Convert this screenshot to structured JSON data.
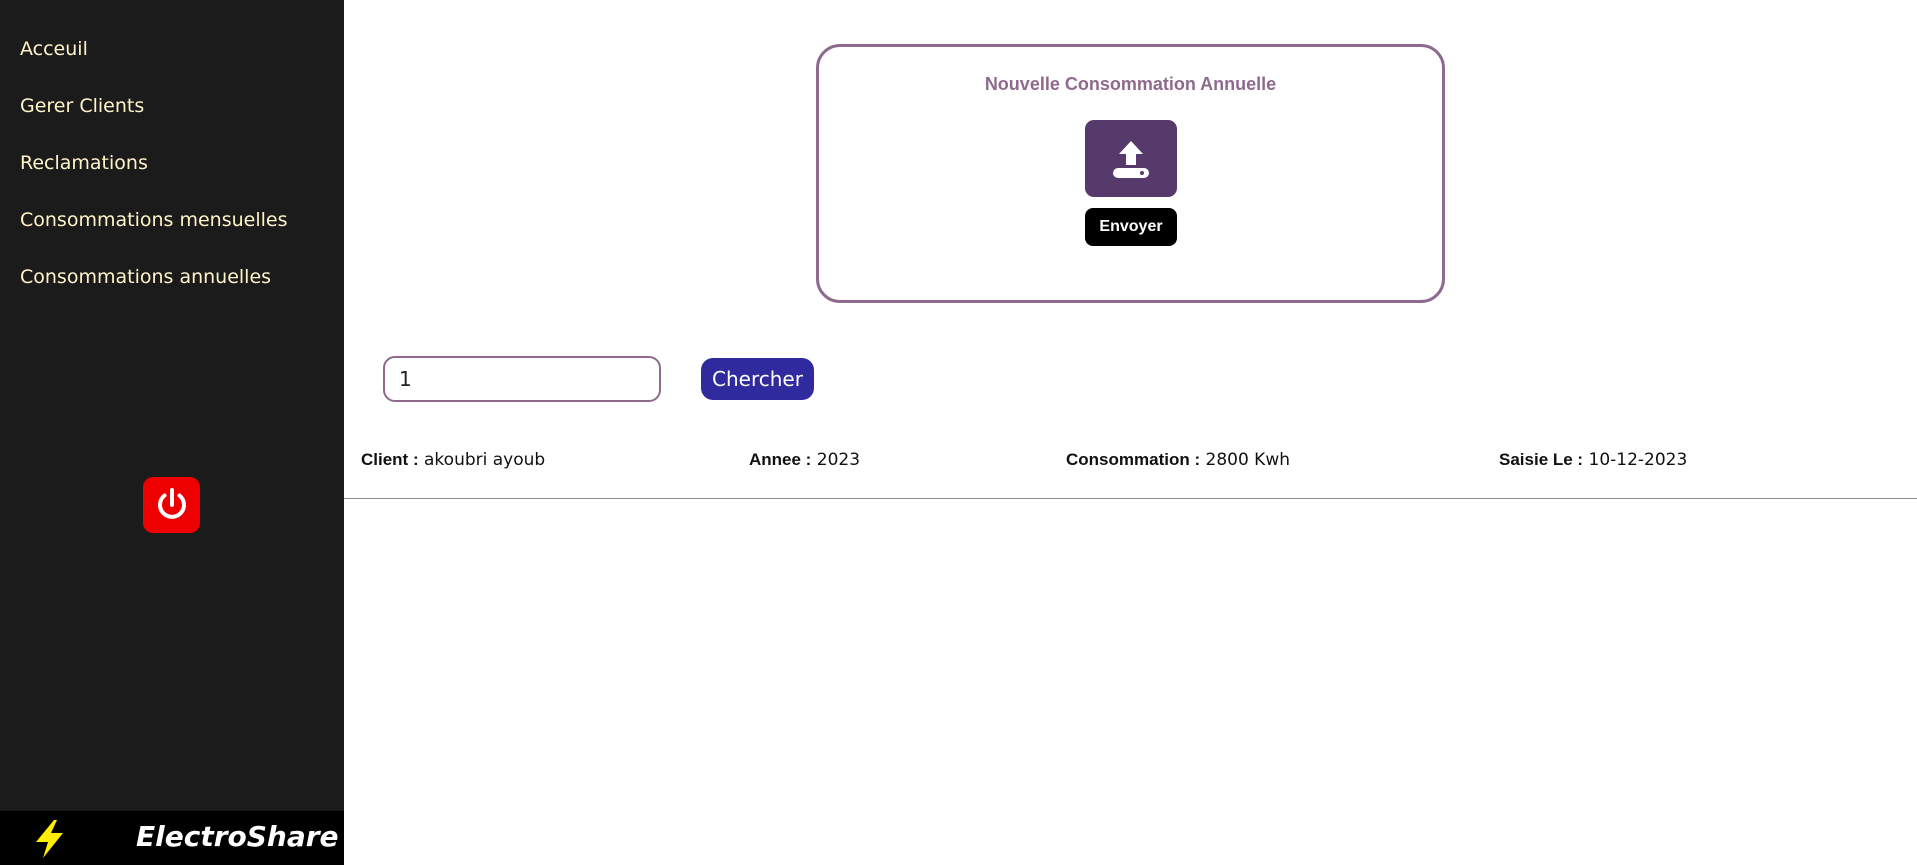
{
  "sidebar": {
    "items": [
      {
        "label": "Acceuil"
      },
      {
        "label": "Gerer Clients"
      },
      {
        "label": "Reclamations"
      },
      {
        "label": "Consommations mensuelles"
      },
      {
        "label": "Consommations annuelles"
      }
    ],
    "power_icon": "power-icon",
    "brand": {
      "icon": "lightning-bolt-icon",
      "name": "ElectroShare"
    }
  },
  "upload_card": {
    "title": "Nouvelle Consommation Annuelle",
    "upload_icon": "upload-icon",
    "send_label": "Envoyer"
  },
  "search": {
    "value": "1",
    "button_label": "Chercher"
  },
  "record": {
    "client_label": "Client :",
    "client_value": "akoubri ayoub",
    "annee_label": "Annee :",
    "annee_value": "2023",
    "consommation_label": "Consommation :",
    "consommation_value": "2800 Kwh",
    "saisie_label": "Saisie Le :",
    "saisie_value": "10-12-2023"
  },
  "colors": {
    "sidebar_bg": "#1b1b1b",
    "nav_text": "#fff4c9",
    "accent_purple": "#8e6a8e",
    "upload_bg": "#553a6b",
    "search_btn": "#2f2a9e",
    "power_red": "#ee0000",
    "bolt_yellow": "#ffee00"
  }
}
